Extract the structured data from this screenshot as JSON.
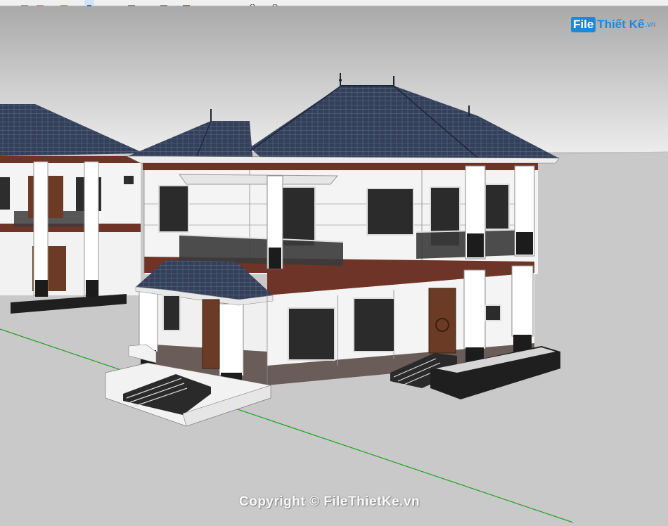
{
  "app": {
    "toolbar_icons": [
      "select-tool-icon",
      "eraser-tool-icon",
      "paint-tool-icon",
      "move-tool-icon",
      "rotate-tool-icon",
      "scale-tool-icon",
      "orbit-tool-icon",
      "zoom-tool-icon"
    ]
  },
  "watermark": {
    "logo_file": "File",
    "logo_rest": "Thiết Kế",
    "logo_ext": ".vn",
    "copyright": "Copyright © FileThietKe.vn"
  },
  "colors": {
    "sky_top": "#a9a9a9",
    "sky_bottom": "#f2f2f2",
    "ground": "#c9c9c9",
    "roof": "#34405a",
    "wall": "#f4f4f4",
    "band": "#6e3428",
    "plinth": "#6a5c58",
    "axis_green": "#20a020",
    "brand": "#1e88d8"
  }
}
